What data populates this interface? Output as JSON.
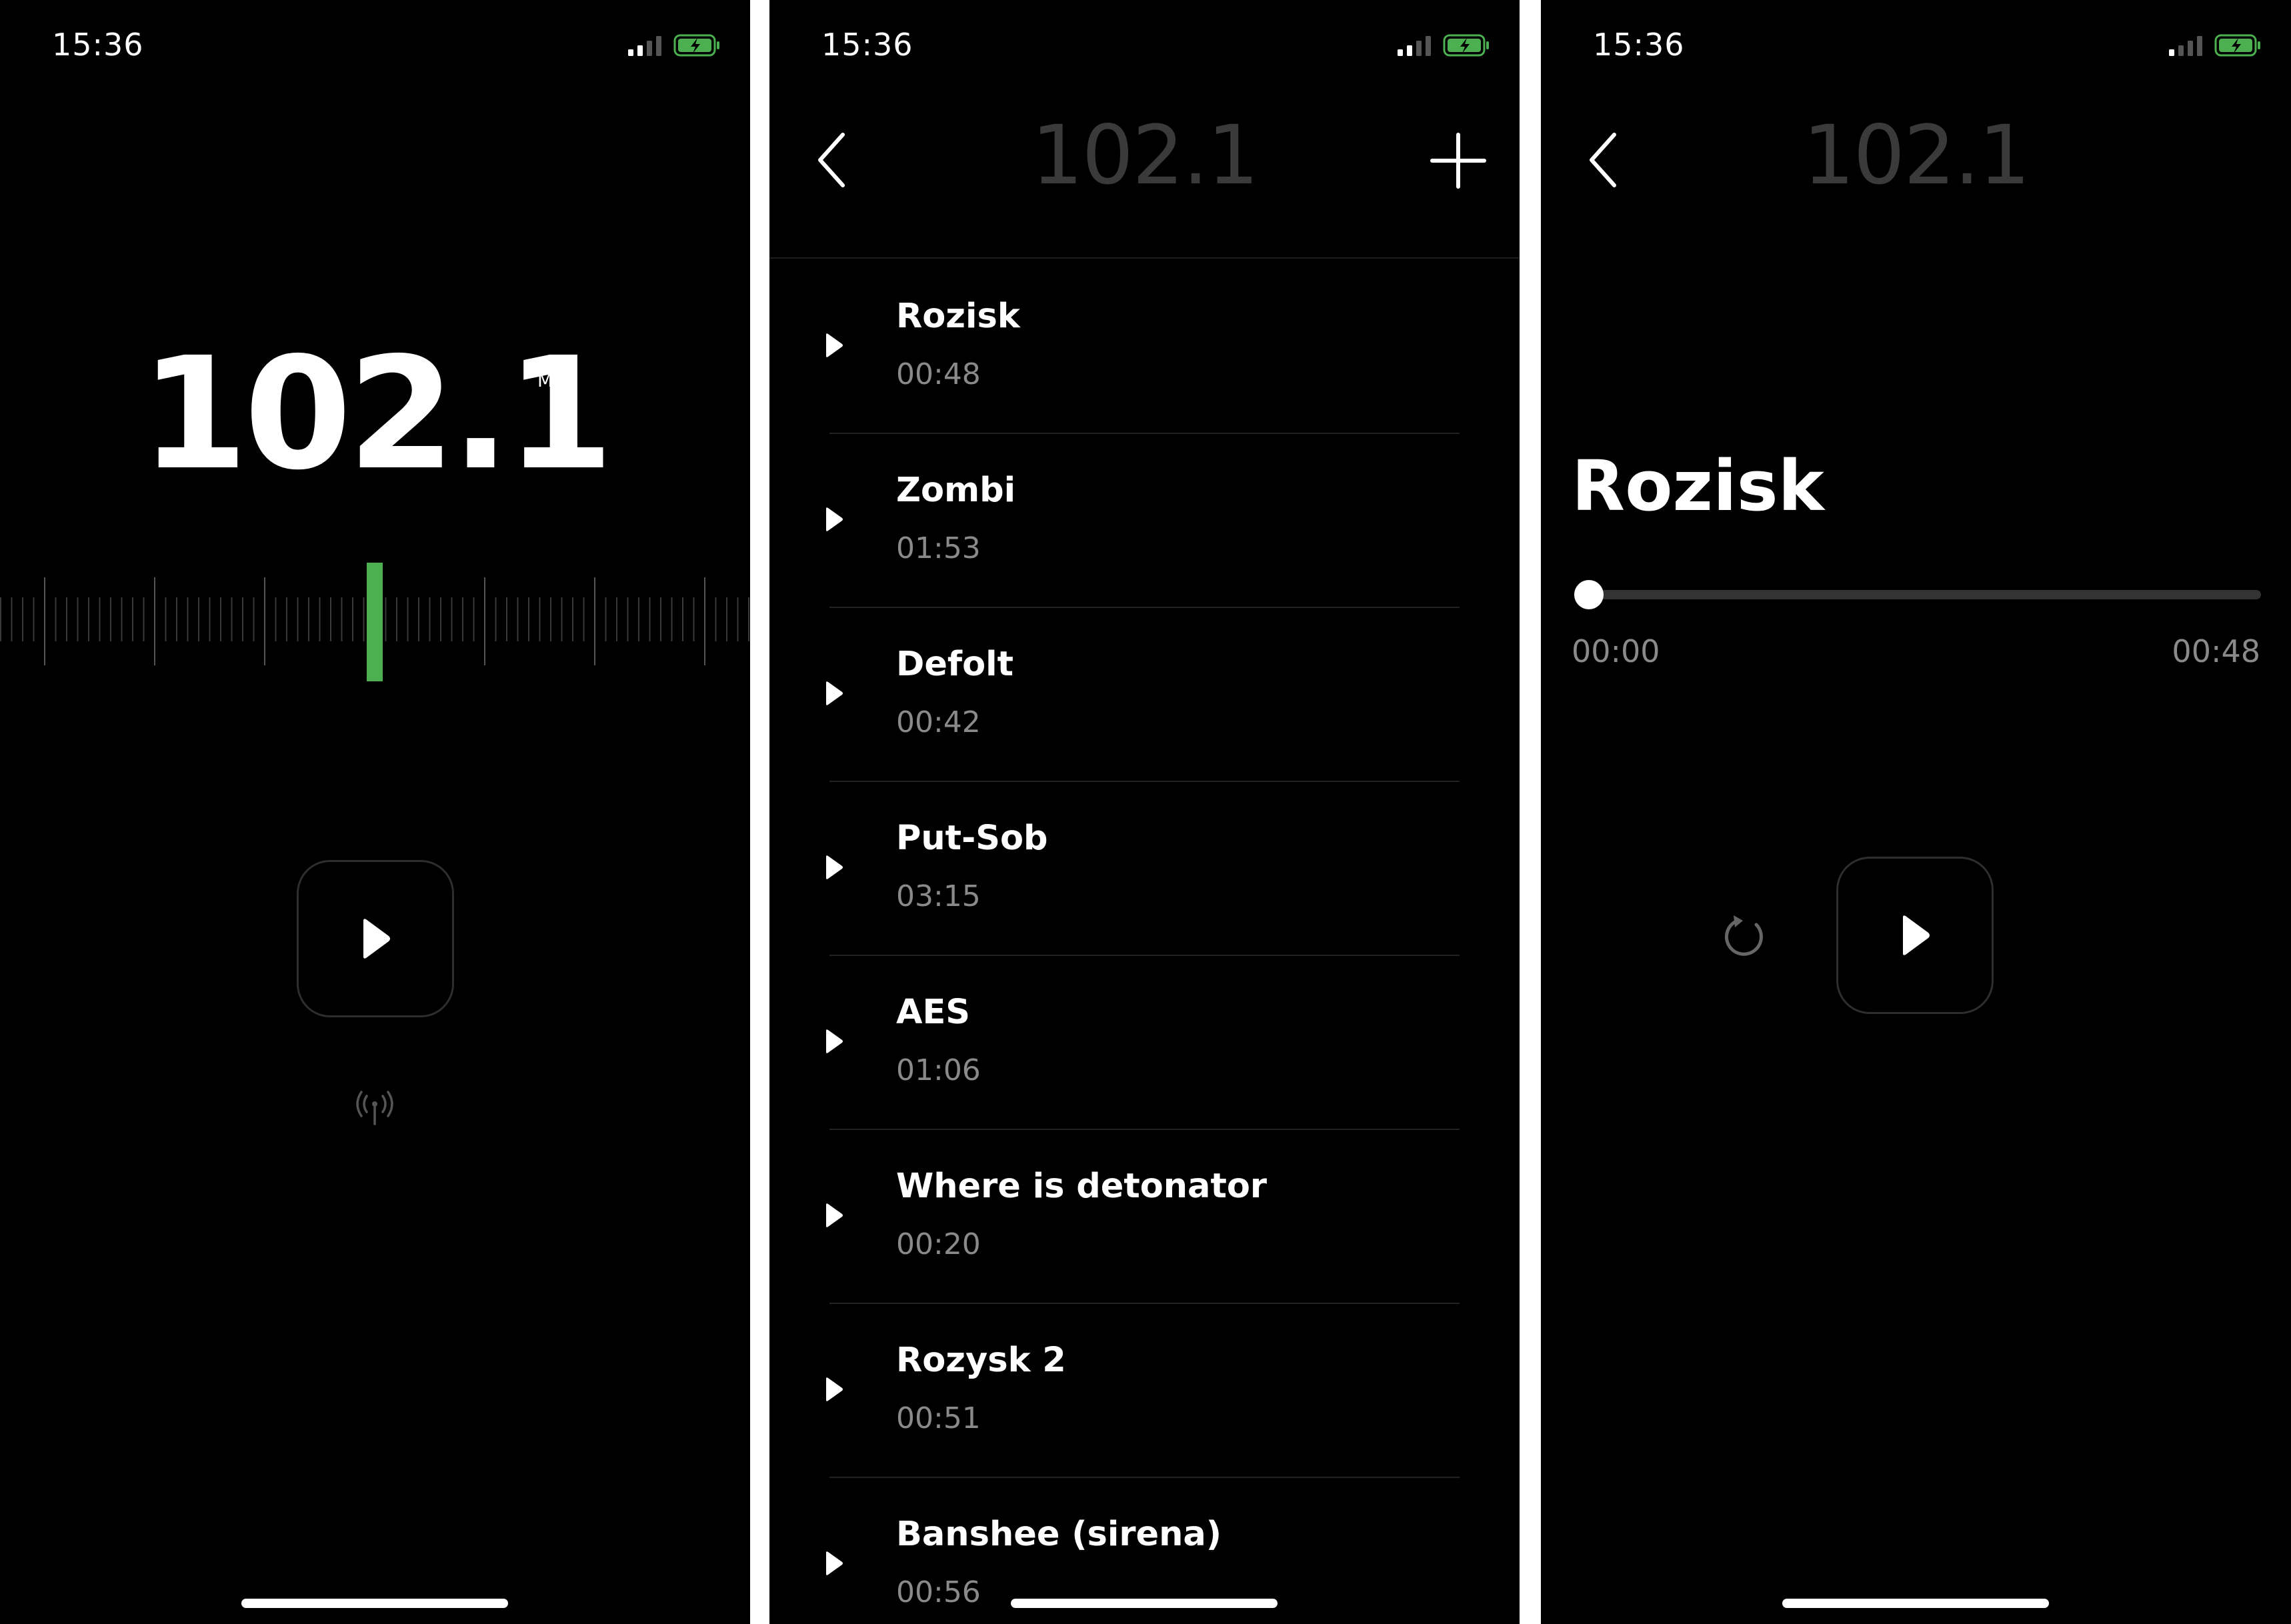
{
  "colors": {
    "background": "#000000",
    "accent_green": "#4caf50",
    "text_primary": "#ffffff",
    "text_secondary": "#8a8a8a",
    "title_dim": "#3a3a3a"
  },
  "status_bar": {
    "time": "15:36",
    "signal_icon": "cellular-signal-icon",
    "battery_icon": "battery-charging-icon"
  },
  "radio_screen": {
    "frequency": "102.1",
    "unit": "MHz",
    "play_icon": "play-icon",
    "antenna_icon": "antenna-icon"
  },
  "recordings_screen": {
    "title": "102.1",
    "back_icon": "chevron-left-icon",
    "add_icon": "plus-icon",
    "recordings": [
      {
        "title": "Rozisk",
        "duration": "00:48"
      },
      {
        "title": "Zombi",
        "duration": "01:53"
      },
      {
        "title": "Defolt",
        "duration": "00:42"
      },
      {
        "title": "Put-Sob",
        "duration": "03:15"
      },
      {
        "title": "AES",
        "duration": "01:06"
      },
      {
        "title": "Where is detonator",
        "duration": "00:20"
      },
      {
        "title": "Rozysk 2",
        "duration": "00:51"
      },
      {
        "title": "Banshee (sirena)",
        "duration": "00:56"
      }
    ]
  },
  "player_screen": {
    "title": "102.1",
    "back_icon": "chevron-left-icon",
    "track_title": "Rozisk",
    "elapsed": "00:00",
    "total": "00:48",
    "progress": 0,
    "replay_icon": "replay-icon",
    "play_icon": "play-icon"
  }
}
